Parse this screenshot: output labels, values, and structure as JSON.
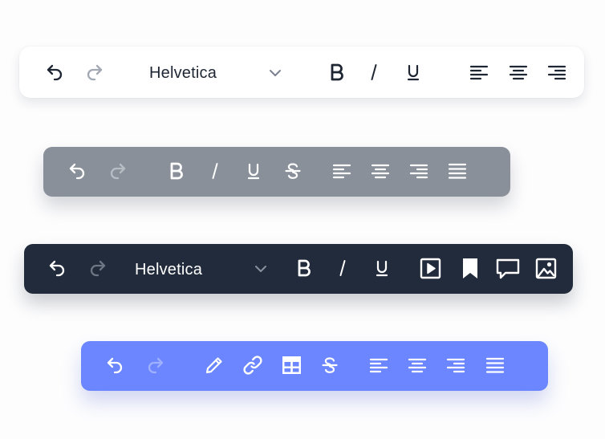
{
  "colors": {
    "page_background": "#fdfdfe",
    "toolbar_white": "#ffffff",
    "toolbar_gray": "#8a909a",
    "toolbar_dark": "#222b3b",
    "toolbar_blue": "#6b86ff",
    "icon_dark": "#1f2633",
    "icon_light": "#ffffff",
    "icon_disabled_on_white": "#a3a9b3",
    "icon_disabled_on_gray": "#b8bcc3",
    "icon_disabled_on_dark": "#6e7685",
    "icon_disabled_on_blue": "#9fb0ff"
  },
  "toolbars": [
    {
      "theme": "white",
      "font_select": {
        "value": "Helvetica"
      },
      "icons": [
        "undo-icon",
        "redo-icon",
        "chevron-down-icon",
        "bold-icon",
        "italic-icon",
        "underline-icon",
        "align-left-icon",
        "align-center-icon",
        "align-right-icon"
      ]
    },
    {
      "theme": "gray",
      "icons": [
        "undo-icon",
        "redo-icon",
        "bold-icon",
        "italic-icon",
        "underline-icon",
        "strikethrough-icon",
        "align-left-icon",
        "align-center-icon",
        "align-right-icon",
        "align-justify-icon"
      ]
    },
    {
      "theme": "dark",
      "font_select": {
        "value": "Helvetica"
      },
      "icons": [
        "undo-icon",
        "redo-icon",
        "chevron-down-icon",
        "bold-icon",
        "italic-icon",
        "underline-icon",
        "video-icon",
        "bookmark-icon",
        "comment-icon",
        "image-icon"
      ]
    },
    {
      "theme": "blue",
      "icons": [
        "undo-icon",
        "redo-icon",
        "pencil-icon",
        "link-icon",
        "table-icon",
        "strikethrough-icon",
        "align-left-icon",
        "align-center-icon",
        "align-right-icon",
        "align-justify-icon"
      ]
    }
  ]
}
